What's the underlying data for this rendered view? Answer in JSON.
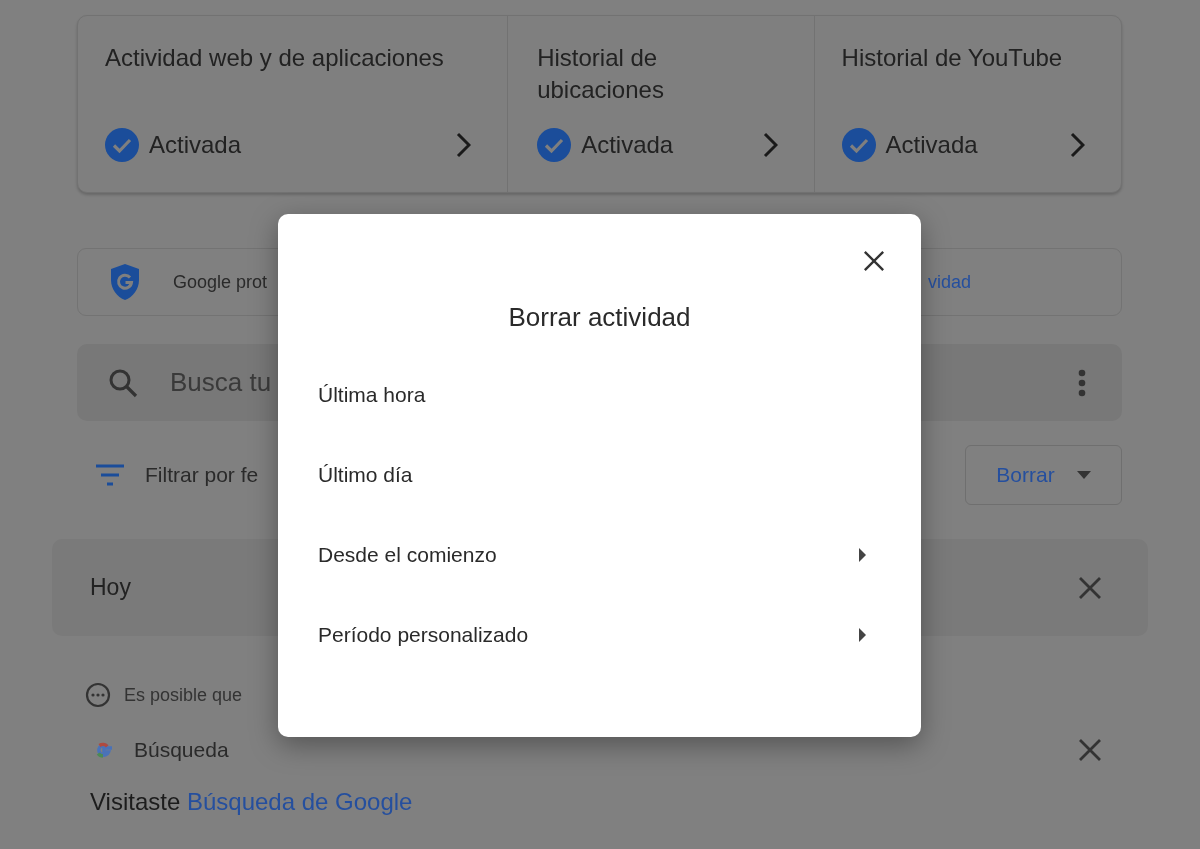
{
  "activity_controls": [
    {
      "title": "Actividad web y de aplicaciones",
      "status": "Activada",
      "on": true
    },
    {
      "title": "Historial de ubicaciones",
      "status": "Activada",
      "on": true
    },
    {
      "title": "Historial de YouTube",
      "status": "Activada",
      "on": true
    }
  ],
  "protection_banner": {
    "text": "Google prot",
    "link": "vidad"
  },
  "search": {
    "placeholder": "Busca tu"
  },
  "filter": {
    "label": "Filtrar por fe"
  },
  "delete_button": {
    "label": "Borrar"
  },
  "day_header": {
    "label": "Hoy"
  },
  "notice": {
    "text": "Es posible que"
  },
  "entry": {
    "product": "Búsqueda",
    "prefix": "Visitaste",
    "link": "Búsqueda de Google"
  },
  "dialog": {
    "title": "Borrar actividad",
    "options": [
      {
        "label": "Última hora",
        "has_submenu": false
      },
      {
        "label": "Último día",
        "has_submenu": false
      },
      {
        "label": "Desde el comienzo",
        "has_submenu": true
      },
      {
        "label": "Período personalizado",
        "has_submenu": true
      }
    ]
  }
}
